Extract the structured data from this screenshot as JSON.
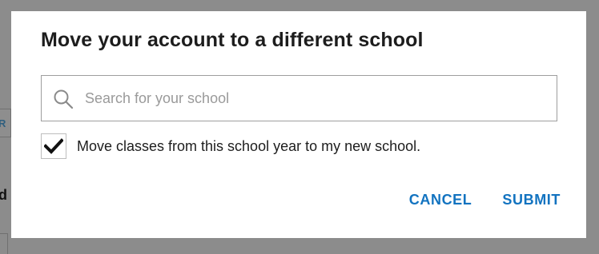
{
  "background": {
    "box_letter": "R",
    "letter": "d"
  },
  "dialog": {
    "title": "Move your account to a different school",
    "search": {
      "placeholder": "Search for your school",
      "value": ""
    },
    "move_classes": {
      "checked": true,
      "label": "Move classes from this school year to my new school."
    },
    "cancel_label": "CANCEL",
    "submit_label": "SUBMIT"
  },
  "icons": {
    "search": "search-icon",
    "checkmark": "checkmark-icon"
  },
  "colors": {
    "overlay": "#8c8c8c",
    "dialog_background": "#ffffff",
    "action_text": "#1273c0",
    "title_text": "#1d1d1d",
    "placeholder_text": "#9a9a9a"
  }
}
